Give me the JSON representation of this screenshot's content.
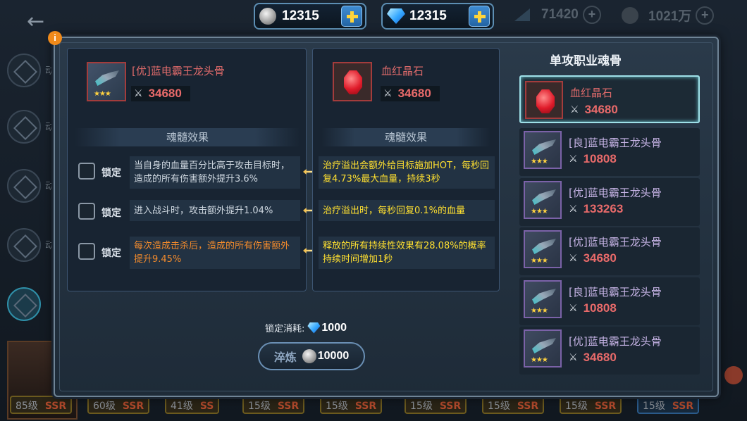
{
  "top_bar": {
    "silver": "12315",
    "diamond": "12315",
    "dim_currency_1": "71420",
    "dim_currency_2": "1021万"
  },
  "side_nav": [
    {
      "icon": "plant-icon",
      "label": "动"
    },
    {
      "icon": "sun-icon",
      "label": "动"
    },
    {
      "icon": "compass-icon",
      "label": "动"
    },
    {
      "icon": "wolf-icon",
      "label": "动"
    },
    {
      "icon": "shield-icon",
      "label": ""
    }
  ],
  "bottom_chips": [
    {
      "level": "85级",
      "rarity": "SSR"
    },
    {
      "level": "60级",
      "rarity": "SSR"
    },
    {
      "level": "41级",
      "rarity": "SS"
    },
    {
      "level": "15级",
      "rarity": "SSR"
    },
    {
      "level": "15级",
      "rarity": "SSR"
    },
    {
      "level": "15级",
      "rarity": "SSR"
    },
    {
      "level": "15级",
      "rarity": "SSR"
    },
    {
      "level": "15级",
      "rarity": "SSR"
    },
    {
      "level": "15级",
      "rarity": "SSR"
    }
  ],
  "left_item": {
    "name": "[优]蓝电霸王龙头骨",
    "power": "34680",
    "stars": "★★★",
    "section_title": "魂髓效果",
    "lock_label": "锁定",
    "effects": [
      "当自身的血量百分比高于攻击目标时，造成的所有伤害额外提升3.6%",
      "进入战斗时，攻击额外提升1.04%",
      "每次造成击杀后，造成的所有伤害额外提升9.45%"
    ]
  },
  "mid_item": {
    "name": "血红晶石",
    "power": "34680",
    "section_title": "魂髓效果",
    "effects": [
      "治疗溢出会额外给目标施加HOT，每秒回复4.73%最大血量，持续3秒",
      "治疗溢出时，每秒回复0.1%的血量",
      "释放的所有持续性效果有28.08%的概率持续时间增加1秒"
    ]
  },
  "cost": {
    "label": "锁定消耗:",
    "value": "1000"
  },
  "refine_button": {
    "label": "淬炼",
    "cost": "10000"
  },
  "right_list": {
    "title": "单攻职业魂骨",
    "items": [
      {
        "name": "血红晶石",
        "power": "34680",
        "kind": "ruby",
        "selected": true
      },
      {
        "name": "[良]蓝电霸王龙头骨",
        "power": "10808",
        "kind": "weapon",
        "stars": "★★★"
      },
      {
        "name": "[优]蓝电霸王龙头骨",
        "power": "133263",
        "kind": "weapon",
        "stars": "★★★"
      },
      {
        "name": "[优]蓝电霸王龙头骨",
        "power": "34680",
        "kind": "weapon",
        "stars": "★★★"
      },
      {
        "name": "[良]蓝电霸王龙头骨",
        "power": "10808",
        "kind": "weapon",
        "stars": "★★★"
      },
      {
        "name": "[优]蓝电霸王龙头骨",
        "power": "34680",
        "kind": "weapon",
        "stars": "★★★"
      }
    ]
  },
  "colors": {
    "name_red": "#e06b6b",
    "effect_white": "#cdd6df",
    "effect_orange": "#f38b2c",
    "effect_yellow": "#ffe030",
    "selected_border": "#9fe0e8"
  },
  "info_badge": "i"
}
